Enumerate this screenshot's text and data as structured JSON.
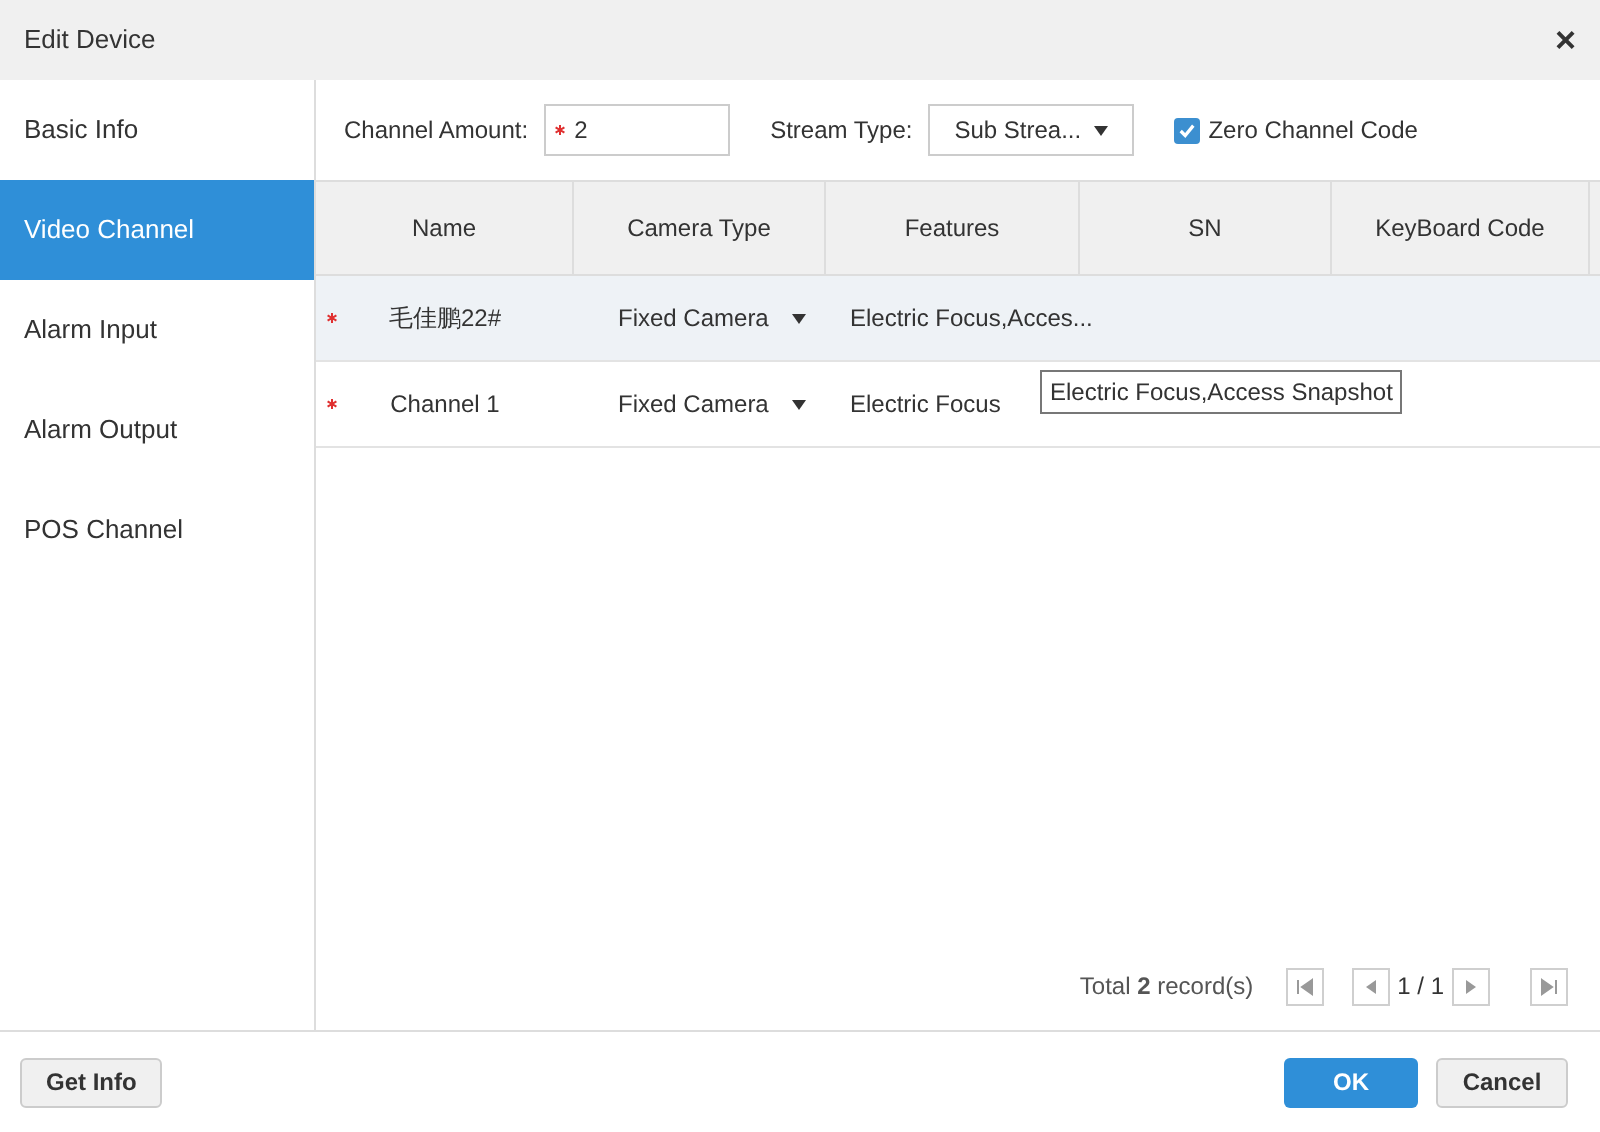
{
  "window": {
    "title": "Edit Device",
    "close": "×"
  },
  "sidebar": {
    "items": [
      {
        "label": "Basic Info",
        "selected": false
      },
      {
        "label": "Video Channel",
        "selected": true
      },
      {
        "label": "Alarm Input",
        "selected": false
      },
      {
        "label": "Alarm Output",
        "selected": false
      },
      {
        "label": "POS Channel",
        "selected": false
      }
    ]
  },
  "toolbar": {
    "channel_amount": {
      "label": "Channel Amount:",
      "required": true,
      "value": "2"
    },
    "stream_type": {
      "label": "Stream Type:",
      "value": "Sub Strea..."
    },
    "zero_channel_code": {
      "label": "Zero Channel Code",
      "checked": true
    }
  },
  "table": {
    "columns": [
      "Name",
      "Camera Type",
      "Features",
      "SN",
      "KeyBoard Code"
    ],
    "rows": [
      {
        "required": true,
        "selected": true,
        "name": "毛佳鹏22#",
        "camera_type": "Fixed Camera",
        "features": "Electric Focus,Acces..."
      },
      {
        "required": true,
        "selected": false,
        "name": "Channel 1",
        "camera_type": "Fixed Camera",
        "features": "Electric Focus"
      }
    ]
  },
  "tooltip": "Electric Focus,Access Snapshot",
  "pagination": {
    "summary": "Total **2** record(s)",
    "page": "1 / 1"
  },
  "buttons": {
    "get_info": "Get Info",
    "ok": "OK",
    "cancel": "Cancel"
  }
}
